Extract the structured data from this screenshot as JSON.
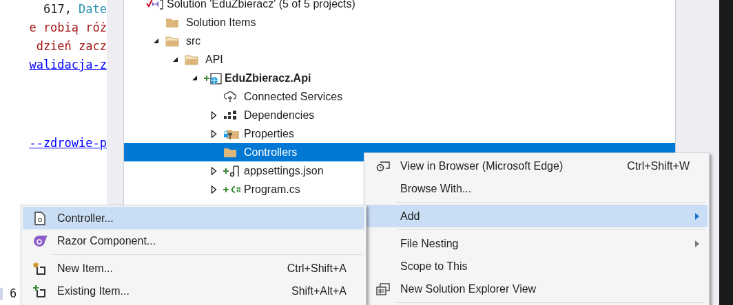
{
  "editor": {
    "lines": [
      {
        "kind": "code",
        "parts": [
          {
            "kind": "number",
            "text": "617,"
          },
          {
            "kind": "type",
            "text": "Date"
          }
        ]
      },
      {
        "kind": "code",
        "parts": [
          {
            "kind": "string",
            "text": "e robią róż"
          }
        ]
      },
      {
        "kind": "code",
        "parts": [
          {
            "kind": "string",
            "text": "dzień zacz"
          }
        ]
      },
      {
        "kind": "code",
        "parts": [
          {
            "kind": "link",
            "text": "walidacja-z"
          }
        ]
      },
      {
        "kind": "blank"
      },
      {
        "kind": "blank"
      },
      {
        "kind": "blank"
      },
      {
        "kind": "code",
        "parts": [
          {
            "kind": "link",
            "text": "--zdrowie-p"
          }
        ]
      }
    ],
    "bottom_line": "6"
  },
  "solution_explorer": {
    "items": [
      {
        "label": "Solution 'EduZbieracz' (5 of 5 projects)",
        "kind": "solution",
        "selected": false,
        "children": [
          {
            "label": "Solution Items",
            "kind": "folder",
            "selected": false
          },
          {
            "label": "src",
            "kind": "open-folder",
            "expanded": true,
            "selected": false,
            "children": [
              {
                "label": "API",
                "kind": "open-folder",
                "expanded": true,
                "selected": false,
                "children": [
                  {
                    "label": "EduZbieracz.Api",
                    "kind": "project",
                    "expanded": true,
                    "selected": false,
                    "children": [
                      {
                        "label": "Connected Services",
                        "kind": "connected",
                        "selected": false
                      },
                      {
                        "label": "Dependencies",
                        "kind": "dependencies",
                        "expanded": false,
                        "selected": false
                      },
                      {
                        "label": "Properties",
                        "kind": "properties",
                        "expanded": false,
                        "selected": false
                      },
                      {
                        "label": "Controllers",
                        "kind": "folder",
                        "selected": true
                      },
                      {
                        "label": "appsettings.json",
                        "kind": "json",
                        "expanded": false,
                        "selected": false
                      },
                      {
                        "label": "Program.cs",
                        "kind": "csharp",
                        "expanded": false,
                        "selected": false
                      }
                    ]
                  }
                ]
              }
            ]
          }
        ]
      }
    ]
  },
  "context_menu": {
    "items": [
      {
        "kind": "item",
        "label": "View in Browser (Microsoft Edge)",
        "shortcut": "Ctrl+Shift+W",
        "selected": false
      },
      {
        "kind": "item",
        "label": "Browse With...",
        "selected": false
      },
      {
        "kind": "separator"
      },
      {
        "kind": "submenu",
        "label": "Add",
        "selected": true
      },
      {
        "kind": "separator"
      },
      {
        "kind": "submenu",
        "label": "File Nesting",
        "selected": false
      },
      {
        "kind": "item",
        "label": "Scope to This",
        "selected": false
      },
      {
        "kind": "item",
        "label": "New Solution Explorer View",
        "selected": false
      },
      {
        "kind": "separator"
      }
    ]
  },
  "add_submenu": {
    "items": [
      {
        "kind": "item",
        "label": "Controller...",
        "selected": true
      },
      {
        "kind": "item",
        "label": "Razor Component...",
        "selected": false
      },
      {
        "kind": "separator"
      },
      {
        "kind": "item",
        "label": "New Item...",
        "shortcut": "Ctrl+Shift+A",
        "selected": false
      },
      {
        "kind": "item",
        "label": "Existing Item...",
        "shortcut": "Shift+Alt+A",
        "selected": false
      }
    ]
  }
}
